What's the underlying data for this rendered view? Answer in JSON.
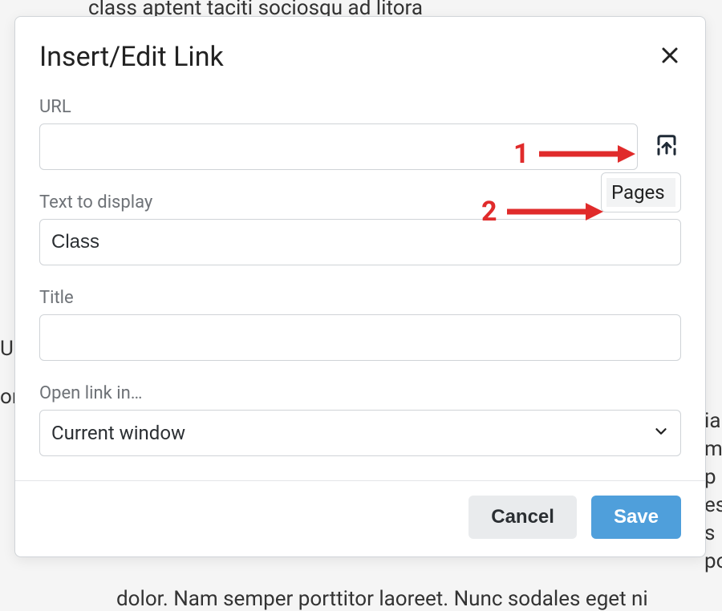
{
  "background": {
    "line1": "class aptent taciti sociosqu ad litora",
    "frag_ia": "ia",
    "frag_m": "m",
    "frag_p": "p",
    "frag_es": "es",
    "frag_s": "s",
    "frag_po": "po",
    "frag_u": "U",
    "frag_on": "on",
    "line_bottom": "dolor. Nam semper porttitor laoreet. Nunc sodales eget ni"
  },
  "dialog": {
    "title": "Insert/Edit Link",
    "url_label": "URL",
    "url_value": "",
    "text_label": "Text to display",
    "text_value": "Class",
    "title_label": "Title",
    "title_value": "",
    "open_label": "Open link in…",
    "open_value": "Current window",
    "menu": {
      "pages": "Pages"
    },
    "buttons": {
      "cancel": "Cancel",
      "save": "Save"
    }
  },
  "annotations": {
    "one": "1",
    "two": "2",
    "arrow_color": "#e02b2b"
  }
}
